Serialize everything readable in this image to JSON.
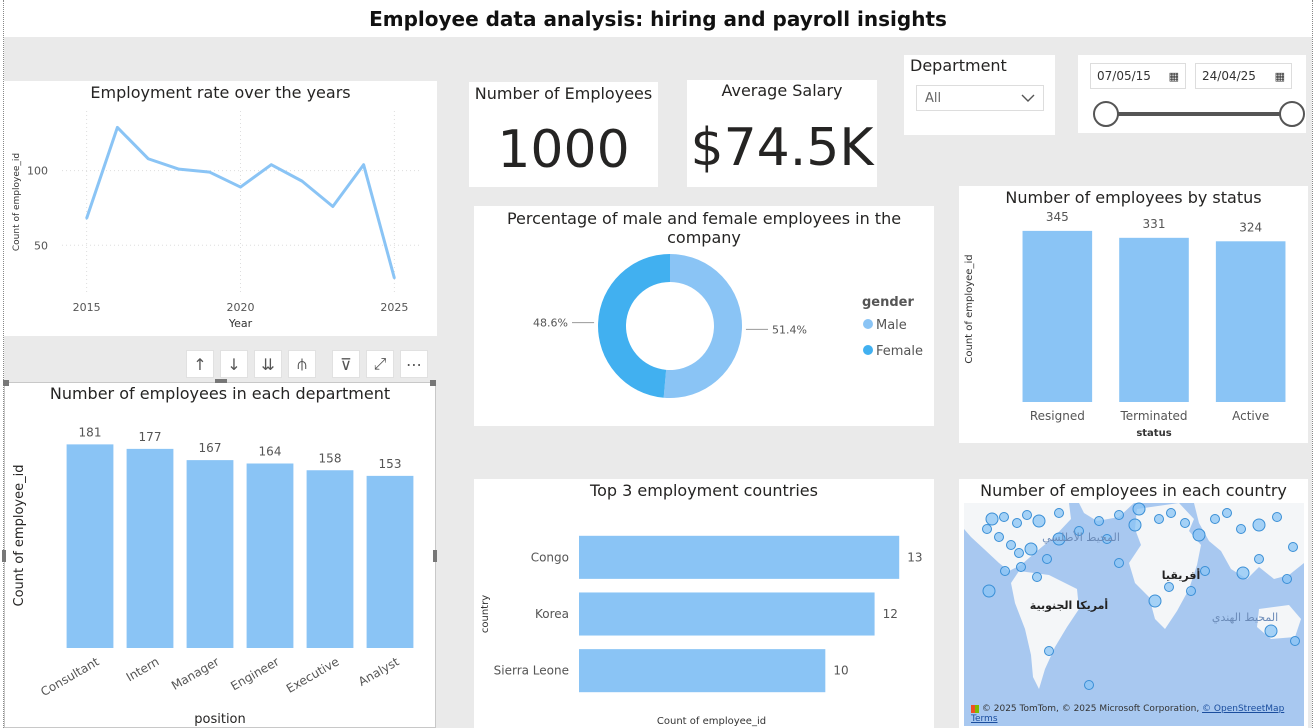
{
  "dashboard_title": "Employee data analysis: hiring and payroll insights",
  "colors": {
    "accent": "#8ac4f5",
    "accent_dark": "#41b0f0",
    "line": "#8ac4f5",
    "map_water": "#a8c8f0",
    "map_land": "#ffffff"
  },
  "kpis": {
    "employees": {
      "label": "Number of Employees",
      "value": "1000"
    },
    "salary": {
      "label": "Average Salary",
      "value": "$74.5K"
    }
  },
  "slicer_department": {
    "label": "Department",
    "value": "All",
    "icon": "chevron-down-icon"
  },
  "slicer_date": {
    "start": "07/05/15",
    "end": "24/04/25",
    "icon": "calendar-icon"
  },
  "toolbar": [
    {
      "name": "sort-up-icon",
      "glyph": "↑"
    },
    {
      "name": "sort-down-icon",
      "glyph": "↓"
    },
    {
      "name": "expand-all-down-icon",
      "glyph": "⇊"
    },
    {
      "name": "drill-down-icon",
      "glyph": "⫛"
    },
    {
      "name": "filter-icon",
      "glyph": "⊽"
    },
    {
      "name": "focus-mode-icon",
      "glyph": "⤢"
    },
    {
      "name": "more-options-icon",
      "glyph": "⋯"
    }
  ],
  "map": {
    "title": "Number of employees in each country",
    "labels": [
      "المحيط الأطلسي",
      "أمريكا الجنوبية",
      "أفريقيا",
      "المحيط الهندي"
    ],
    "attribution_prefix": "© 2025 TomTom, © 2025 Microsoft Corporation, ",
    "attribution_link1": "© OpenStreetMap",
    "attribution_link2": "Terms"
  },
  "chart_data": [
    {
      "id": "line",
      "type": "line",
      "title": "Employment rate over the years",
      "xlabel": "Year",
      "ylabel": "Count of employee_id",
      "x": [
        2015,
        2016,
        2017,
        2018,
        2019,
        2020,
        2021,
        2022,
        2023,
        2024,
        2025
      ],
      "values": [
        68,
        129,
        108,
        101,
        99,
        89,
        104,
        93,
        76,
        104,
        28
      ],
      "xticks": [
        "2015",
        "2020",
        "2025"
      ],
      "yticks": [
        "50",
        "100"
      ],
      "xlim": [
        2014.2,
        2025.8
      ],
      "ylim": [
        18,
        140
      ]
    },
    {
      "id": "dept",
      "type": "bar",
      "title": "Number of employees in each department",
      "xlabel": "position",
      "ylabel": "Count of employee_id",
      "categories": [
        "Consultant",
        "Intern",
        "Manager",
        "Engineer",
        "Executive",
        "Analyst"
      ],
      "values": [
        181,
        177,
        167,
        164,
        158,
        153
      ],
      "ylim": [
        0,
        200
      ]
    },
    {
      "id": "gender",
      "type": "pie",
      "title": "Percentage of male and female employees in the company",
      "legend_title": "gender",
      "categories": [
        "Male",
        "Female"
      ],
      "values": [
        51.4,
        48.6
      ],
      "labels": [
        "51.4%",
        "48.6%"
      ],
      "colors": [
        "#8ac4f5",
        "#41b0f0"
      ]
    },
    {
      "id": "status",
      "type": "bar",
      "title": "Number of employees by status",
      "xlabel": "status",
      "ylabel": "Count of employee_id",
      "categories": [
        "Resigned",
        "Terminated",
        "Active"
      ],
      "values": [
        345,
        331,
        324
      ],
      "ylim": [
        0,
        375
      ]
    },
    {
      "id": "countries",
      "type": "bar",
      "title": "Top 3 employment countries",
      "xlabel": "Count of employee_id",
      "ylabel": "country",
      "categories": [
        "Congo",
        "Korea",
        "Sierra Leone"
      ],
      "values": [
        13,
        12,
        10
      ],
      "xlim": [
        0,
        13.6
      ]
    }
  ]
}
